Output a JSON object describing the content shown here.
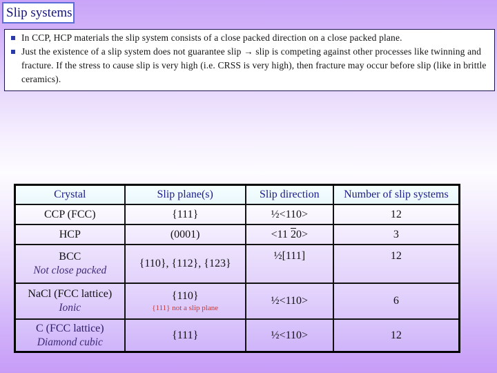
{
  "slide": {
    "title": "Slip systems",
    "bullets": [
      "In CCP, HCP materials the slip system consists of a close packed direction on a close packed plane.",
      "Just the existence of a slip system does not guarantee slip → slip is competing against other processes like twinning and fracture. If the stress to cause slip is very high (i.e. CRSS is very high), then fracture may occur before slip (like in brittle ceramics)."
    ]
  },
  "table": {
    "headers": [
      "Crystal",
      "Slip plane(s)",
      "Slip direction",
      "Number of slip systems"
    ],
    "rows": [
      {
        "crystal": "CCP (FCC)",
        "crystal_note": "",
        "plane": "{111}",
        "plane_note": "",
        "direction": "½<110>",
        "count": "12"
      },
      {
        "crystal": "HCP",
        "crystal_note": "",
        "plane": "(0001)",
        "plane_note": "",
        "direction_prefix": "<11 ",
        "direction_bar": "2",
        "direction_suffix": "0>",
        "count": "3"
      },
      {
        "crystal": "BCC",
        "crystal_note": "Not close packed",
        "plane": "{110}, {112}, {123}",
        "plane_note": "",
        "direction": "½[111]",
        "count": "12"
      },
      {
        "crystal": "NaCl (FCC lattice)",
        "crystal_note": "Ionic",
        "plane": "{110}",
        "plane_note": "{111} not a slip plane",
        "direction": "½<110>",
        "count": "6"
      },
      {
        "crystal": "C (FCC lattice)",
        "crystal_note": "Diamond cubic",
        "plane": "{111}",
        "plane_note": "",
        "direction": "½<110>",
        "count": "12"
      }
    ]
  },
  "colors": {
    "title_text": "#14147a",
    "title_border": "#5a6cd6",
    "header_text": "#1a1a8a",
    "note_red": "#c23a3a",
    "background_top": "#c9a4f8",
    "background_bottom": "#c79cf7"
  }
}
